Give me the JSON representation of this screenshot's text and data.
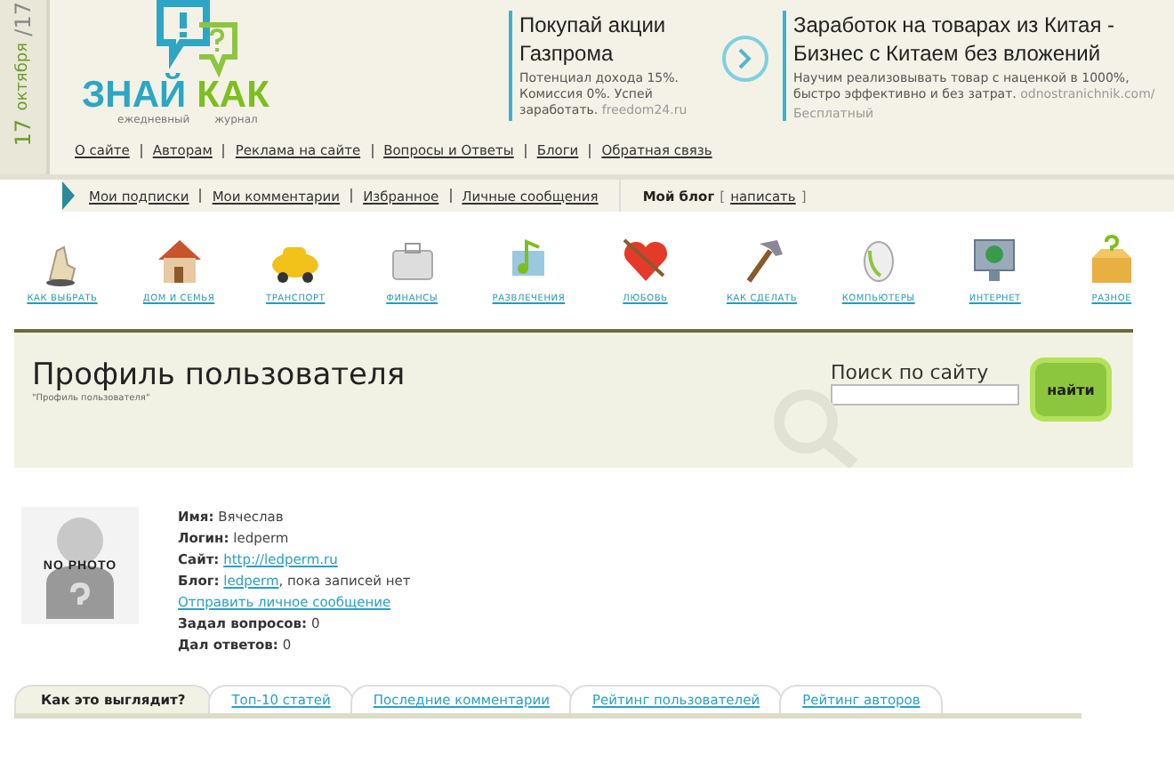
{
  "date": {
    "day": "17",
    "month": "октября",
    "edition": "/17"
  },
  "logo": {
    "word_1": "ЗНАЙ",
    "word_2": "КАК",
    "tagline_1": "ежедневный",
    "tagline_2": "журнал"
  },
  "ads": [
    {
      "title": "Покупай акции Газпрома",
      "description": "Потенциал дохода 15%. Комиссия 0%. Успей заработать.",
      "source": "freedom24.ru"
    },
    {
      "title": "Заработок на товарах из Китая - Бизнес с Китаем без вложений",
      "description": "Научим реализовывать товар с наценкой в 1000%, быстро эффективно и без затрат.",
      "source": "odnostranichnik.com/",
      "note": "Бесплатный"
    }
  ],
  "top_nav": [
    "О сайте",
    "Авторам",
    "Реклама на сайте",
    "Вопросы и Ответы",
    "Блоги",
    "Обратная связь"
  ],
  "user_nav": {
    "links": [
      "Мои подписки",
      "Мои комментарии",
      "Избранное",
      "Личные сообщения"
    ],
    "blog": "Мой блог",
    "bracket_open": "[",
    "write": "написать",
    "bracket_close": "]"
  },
  "categories": [
    {
      "label": "КАК ВЫБРАТЬ",
      "kind": "hand"
    },
    {
      "label": "ДОМ И СЕМЬЯ",
      "kind": "house"
    },
    {
      "label": "ТРАНСПОРТ",
      "kind": "car"
    },
    {
      "label": "ФИНАНСЫ",
      "kind": "case"
    },
    {
      "label": "РАЗВЛЕЧЕНИЯ",
      "kind": "music"
    },
    {
      "label": "ЛЮБОВЬ",
      "kind": "heart"
    },
    {
      "label": "КАК СДЕЛАТЬ",
      "kind": "hammer"
    },
    {
      "label": "КОМПЬЮТЕРЫ",
      "kind": "mouse"
    },
    {
      "label": "ИНТЕРНЕТ",
      "kind": "monitor"
    },
    {
      "label": "РАЗНОЕ",
      "kind": "box"
    }
  ],
  "page_header": {
    "title": "Профиль пользователя",
    "breadcrumb": "\"Профиль пользователя\"",
    "search_label": "Поиск по сайту",
    "search_button": "найти"
  },
  "profile": {
    "photo_text": "NO PHOTO",
    "fields": [
      {
        "label": "Имя:",
        "kind": "text",
        "value": "Вячеслав"
      },
      {
        "label": "Логин:",
        "kind": "text",
        "value": "ledperm"
      },
      {
        "label": "Сайт:",
        "kind": "link",
        "value": "http://ledperm.ru"
      },
      {
        "label": "Блог:",
        "kind": "blog",
        "value": "ledperm",
        "note": ", пока записей нет"
      },
      {
        "kind": "action",
        "value": "Отправить личное сообщение"
      },
      {
        "label": "Задал вопросов:",
        "kind": "text",
        "value": "0"
      },
      {
        "label": "Дал ответов:",
        "kind": "text",
        "value": "0"
      }
    ]
  },
  "tabs": [
    {
      "label": "Как это выглядит?",
      "selected": true
    },
    {
      "label": "Топ-10 статей",
      "selected": false
    },
    {
      "label": "Последние комментарии",
      "selected": false
    },
    {
      "label": "Рейтинг пользователей",
      "selected": false
    },
    {
      "label": "Рейтинг авторов",
      "selected": false
    }
  ]
}
